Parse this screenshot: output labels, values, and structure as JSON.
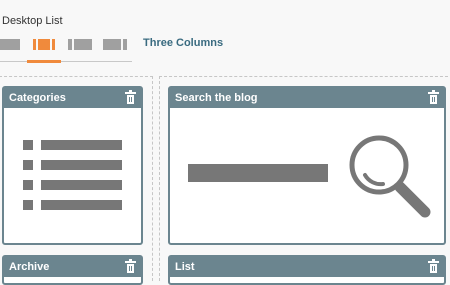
{
  "page": {
    "title": "Desktop List"
  },
  "layout_selector": {
    "selected_label": "Three Columns",
    "options": [
      {
        "id": "one",
        "active": false
      },
      {
        "id": "three",
        "active": true
      },
      {
        "id": "two-right",
        "active": false
      },
      {
        "id": "two-left",
        "active": false
      }
    ]
  },
  "colors": {
    "accent": "#f08a3c",
    "widget_header": "#6b858f",
    "link": "#3a6b80",
    "icon_gray": "#777777"
  },
  "widgets": {
    "categories": {
      "title": "Categories",
      "icon": "trash-icon",
      "preview": "list-icon"
    },
    "search": {
      "title": "Search the blog",
      "icon": "trash-icon",
      "preview": "magnifier-icon"
    },
    "archive": {
      "title": "Archive",
      "icon": "trash-icon"
    },
    "list": {
      "title": "List",
      "icon": "trash-icon"
    }
  }
}
